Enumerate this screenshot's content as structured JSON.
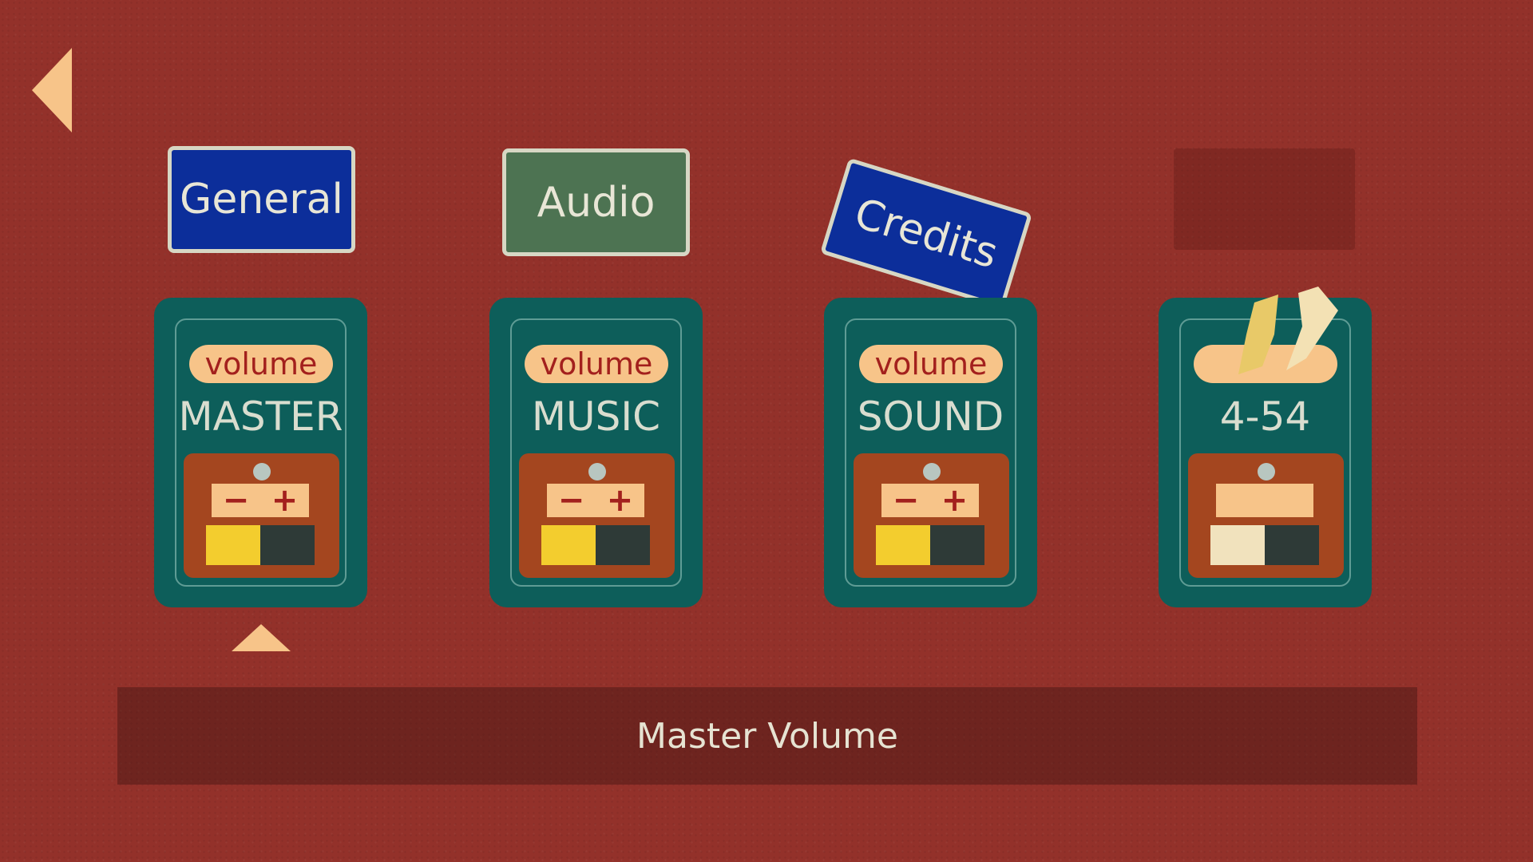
{
  "navigation": {
    "back_icon": "back-arrow-icon"
  },
  "tabs": [
    {
      "label": "General",
      "color": "#0c2e9a"
    },
    {
      "label": "Audio",
      "color": "#4d7352"
    },
    {
      "label": "Credits",
      "color": "#0c2e9a"
    }
  ],
  "cards": [
    {
      "tag": "volume",
      "name": "MASTER",
      "minus": "−",
      "plus": "+",
      "level": 0.5
    },
    {
      "tag": "volume",
      "name": "MUSIC",
      "minus": "−",
      "plus": "+",
      "level": 0.5
    },
    {
      "tag": "volume",
      "name": "SOUND",
      "minus": "−",
      "plus": "+",
      "level": 0.5
    },
    {
      "tag": "",
      "name": "4-54",
      "level": 0.5
    }
  ],
  "info": {
    "text": "Master Volume"
  },
  "colors": {
    "background": "#93312a",
    "card": "#0d5e5a",
    "accent": "#f7c489",
    "level_fill": "#f3cd2e"
  }
}
